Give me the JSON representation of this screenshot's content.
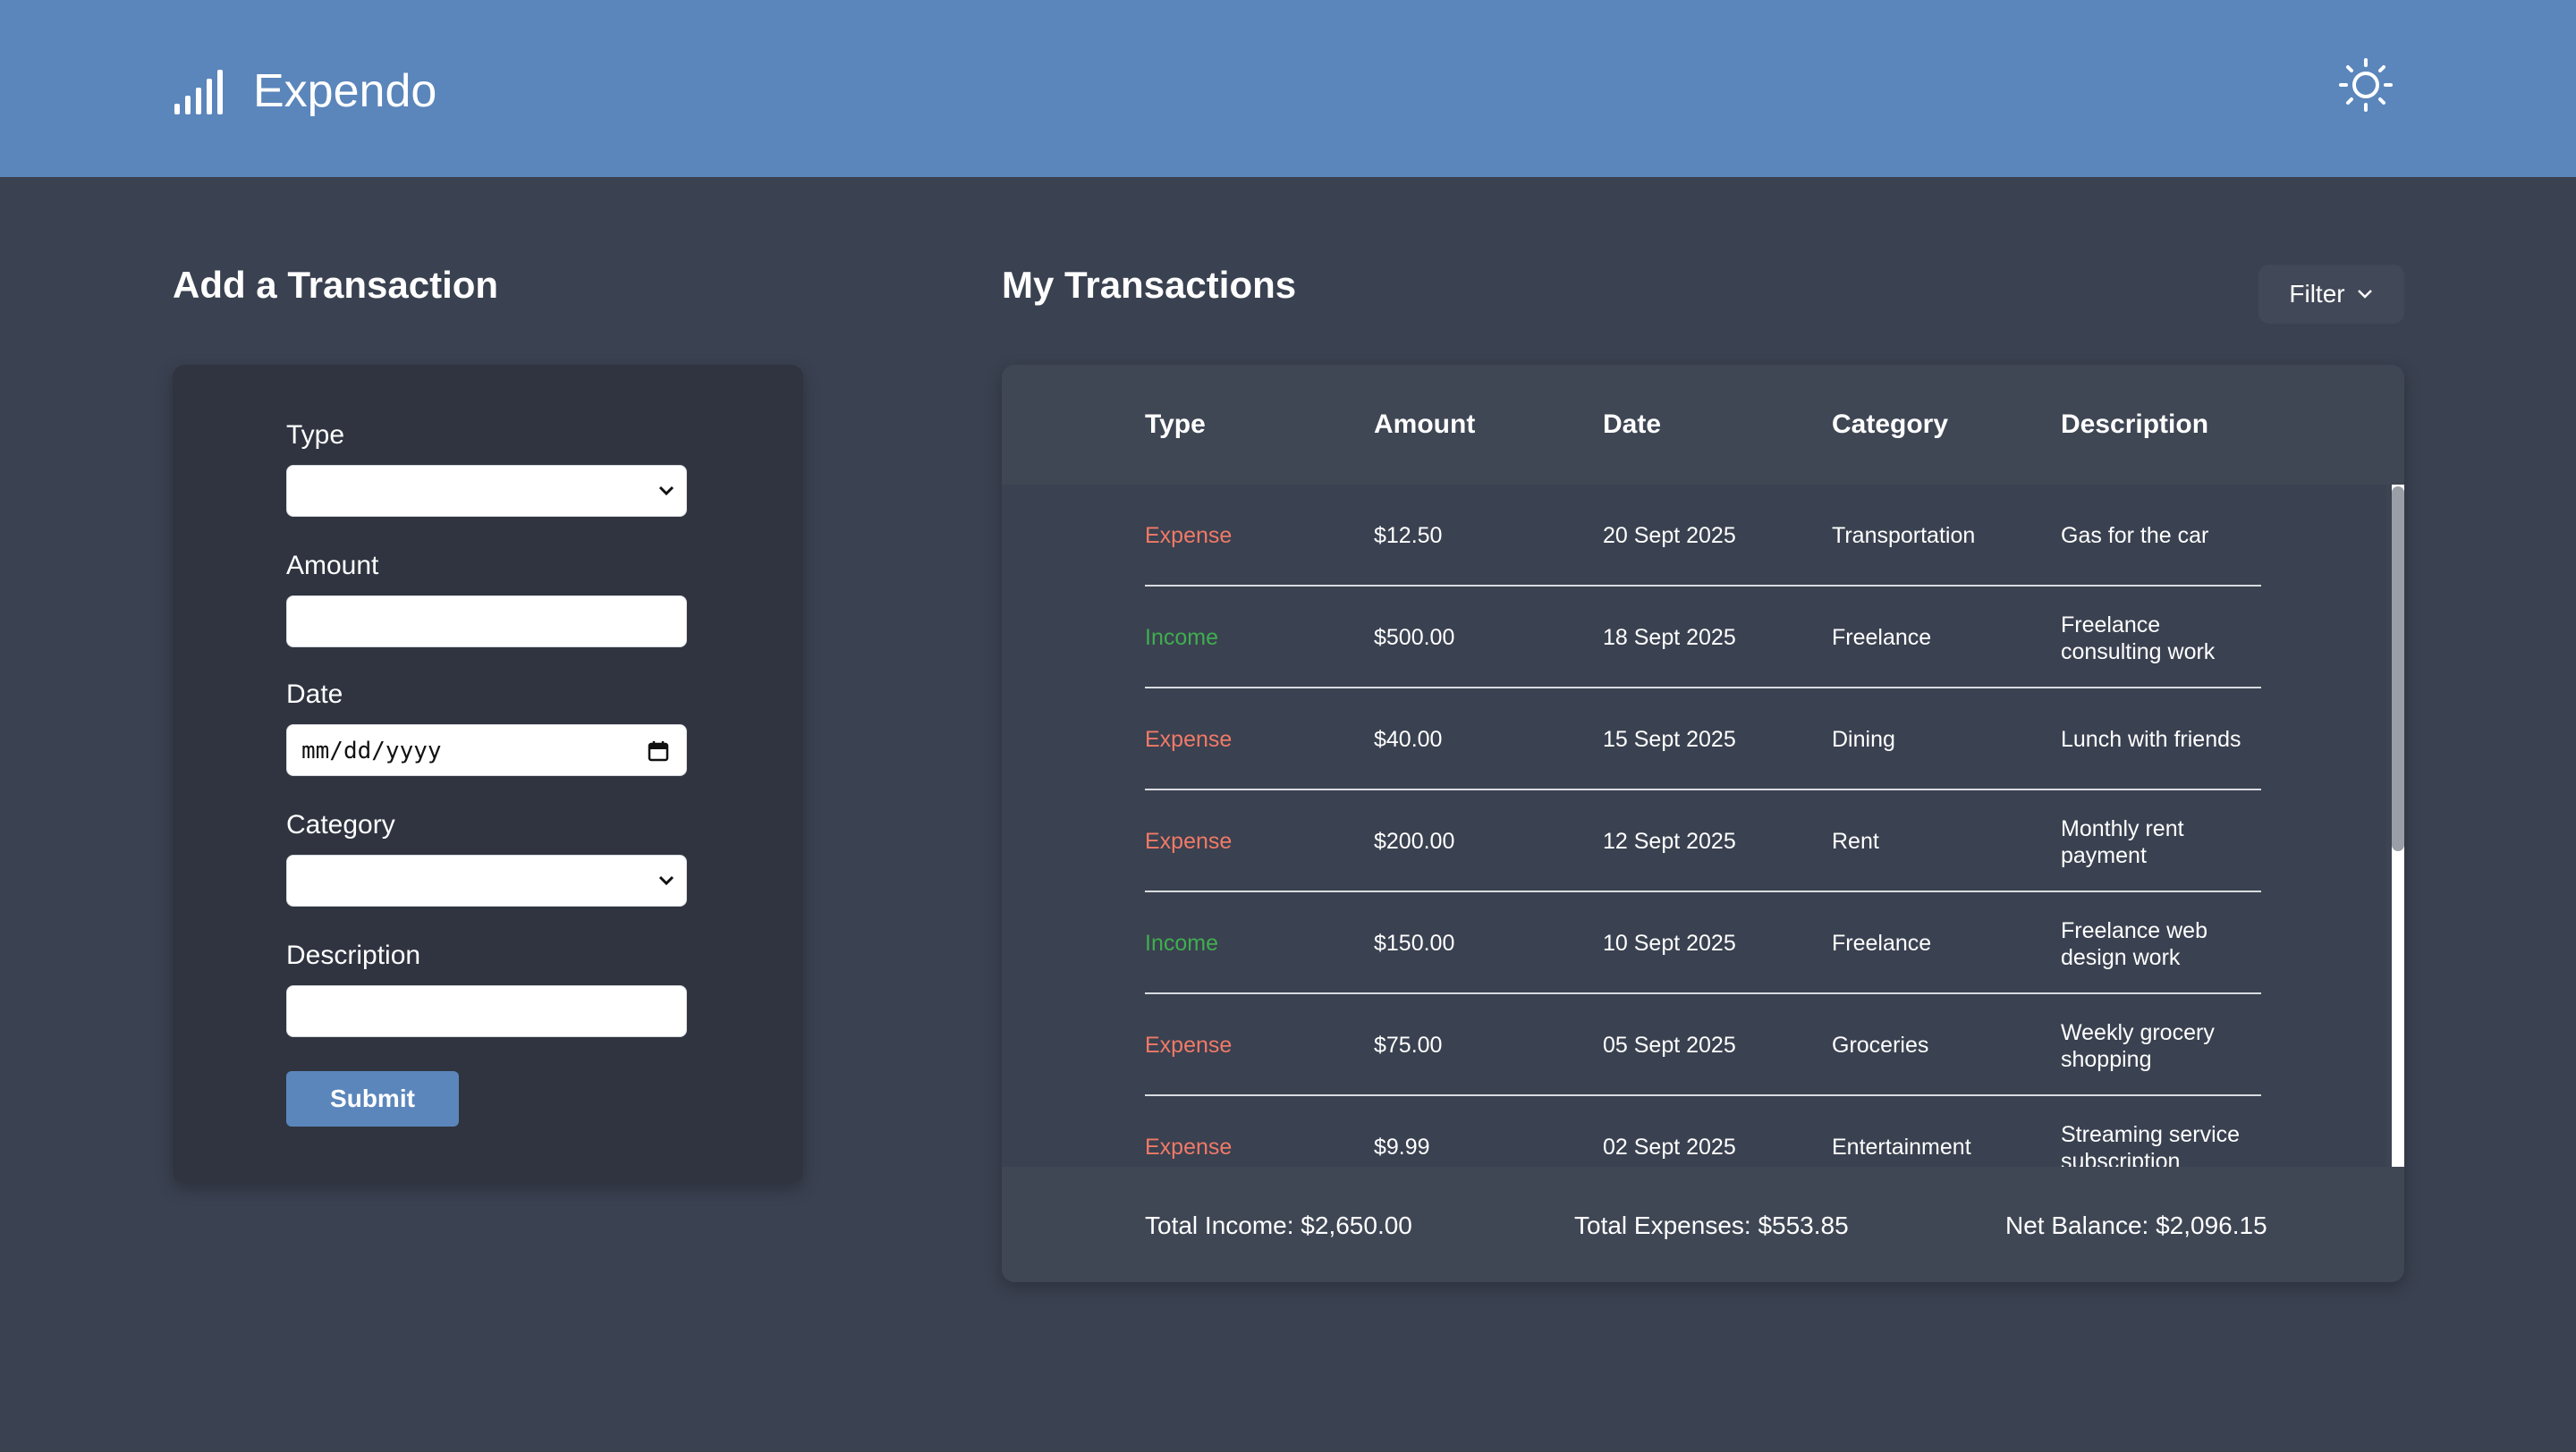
{
  "app": {
    "title": "Expendo",
    "icons": {
      "brand": "signal-bars-icon",
      "theme": "sun-icon"
    },
    "colors": {
      "header": "#5b86bb",
      "background": "#3a4150",
      "expense": "#f07a67",
      "income": "#3fae4f",
      "accent": "#5b86bb"
    }
  },
  "add_form": {
    "title": "Add a Transaction",
    "type_label": "Type",
    "type_value": "",
    "amount_label": "Amount",
    "amount_value": "",
    "date_label": "Date",
    "date_placeholder": "mm/dd/yyyy",
    "category_label": "Category",
    "category_value": "",
    "description_label": "Description",
    "description_value": "",
    "submit_label": "Submit"
  },
  "transactions": {
    "title": "My Transactions",
    "filter_label": "Filter",
    "columns": [
      "Type",
      "Amount",
      "Date",
      "Category",
      "Description"
    ],
    "rows": [
      {
        "type": "Expense",
        "amount": "$12.50",
        "date": "20 Sept 2025",
        "category": "Transportation",
        "description_1": "Gas for the car",
        "description_2": ""
      },
      {
        "type": "Income",
        "amount": "$500.00",
        "date": "18 Sept 2025",
        "category": "Freelance",
        "description_1": "Freelance",
        "description_2": "consulting work"
      },
      {
        "type": "Expense",
        "amount": "$40.00",
        "date": "15 Sept 2025",
        "category": "Dining",
        "description_1": "Lunch with friends",
        "description_2": ""
      },
      {
        "type": "Expense",
        "amount": "$200.00",
        "date": "12 Sept 2025",
        "category": "Rent",
        "description_1": "Monthly rent",
        "description_2": "payment"
      },
      {
        "type": "Income",
        "amount": "$150.00",
        "date": "10 Sept 2025",
        "category": "Freelance",
        "description_1": "Freelance web",
        "description_2": "design work"
      },
      {
        "type": "Expense",
        "amount": "$75.00",
        "date": "05 Sept 2025",
        "category": "Groceries",
        "description_1": "Weekly grocery",
        "description_2": "shopping"
      },
      {
        "type": "Expense",
        "amount": "$9.99",
        "date": "02 Sept 2025",
        "category": "Entertainment",
        "description_1": "Streaming service",
        "description_2": "subscription"
      }
    ],
    "totals": {
      "income": "Total Income: $2,650.00",
      "expenses": "Total Expenses: $553.85",
      "net": "Net Balance: $2,096.15"
    }
  }
}
